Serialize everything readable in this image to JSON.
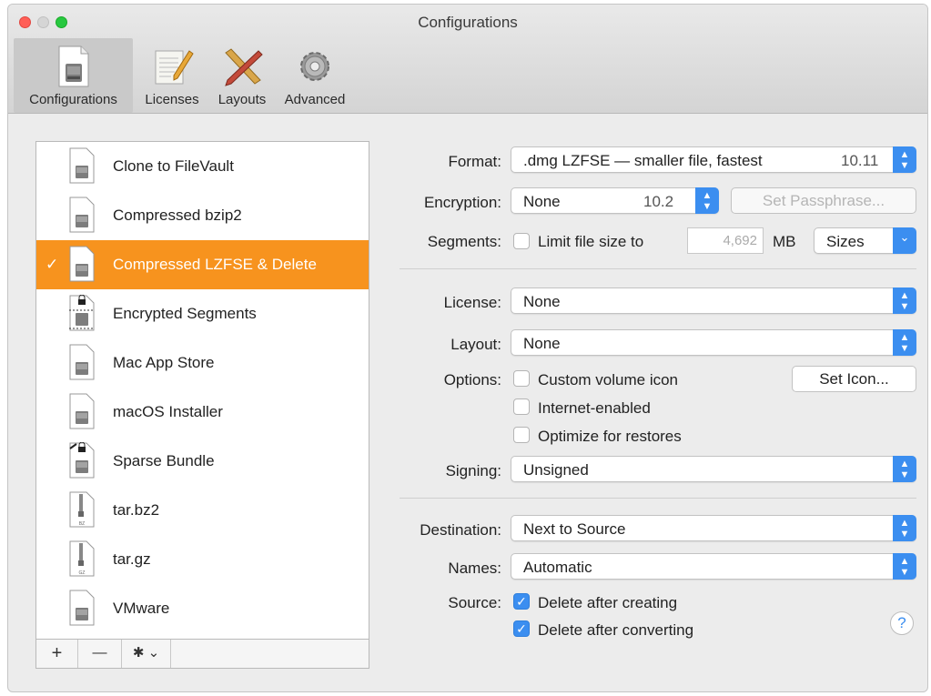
{
  "window": {
    "title": "Configurations"
  },
  "toolbar": {
    "items": [
      {
        "label": "Configurations",
        "icon": "disk-document-icon"
      },
      {
        "label": "Licenses",
        "icon": "notepad-pencil-icon"
      },
      {
        "label": "Layouts",
        "icon": "ruler-pencil-icon"
      },
      {
        "label": "Advanced",
        "icon": "gear-icon"
      }
    ]
  },
  "sidebar": {
    "items": [
      {
        "label": "Clone to FileVault"
      },
      {
        "label": "Compressed bzip2"
      },
      {
        "label": "Compressed LZFSE & Delete",
        "check": "✓"
      },
      {
        "label": "Encrypted Segments"
      },
      {
        "label": "Mac App Store"
      },
      {
        "label": "macOS Installer"
      },
      {
        "label": "Sparse Bundle"
      },
      {
        "label": "tar.bz2",
        "badge": "BZ"
      },
      {
        "label": "tar.gz",
        "badge": "GZ"
      },
      {
        "label": "VMware"
      }
    ],
    "footer": {
      "add": "+",
      "remove": "—",
      "action": "✱ ⌄"
    }
  },
  "form": {
    "format": {
      "label": "Format:",
      "value": ".dmg LZFSE — smaller file, fastest",
      "version": "10.11"
    },
    "encryption": {
      "label": "Encryption:",
      "value": "None",
      "version": "10.2",
      "passphrase_button": "Set Passphrase..."
    },
    "segments": {
      "label": "Segments:",
      "checkbox_label": "Limit file size to",
      "size": "4,692",
      "unit": "MB",
      "sizes_popup": "Sizes"
    },
    "license": {
      "label": "License:",
      "value": "None"
    },
    "layout": {
      "label": "Layout:",
      "value": "None"
    },
    "options": {
      "label": "Options:",
      "custom_icon": "Custom volume icon",
      "set_icon_button": "Set Icon...",
      "internet_enabled": "Internet-enabled",
      "optimize": "Optimize for restores"
    },
    "signing": {
      "label": "Signing:",
      "value": "Unsigned"
    },
    "destination": {
      "label": "Destination:",
      "value": "Next to Source"
    },
    "names": {
      "label": "Names:",
      "value": "Automatic"
    },
    "source": {
      "label": "Source:",
      "delete_creating": "Delete after creating",
      "delete_converting": "Delete after converting"
    },
    "help": "?"
  },
  "colors": {
    "accent": "#3b8ef0",
    "selection": "#f7931e"
  }
}
